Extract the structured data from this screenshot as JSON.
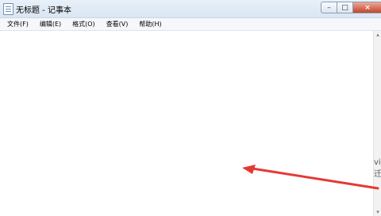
{
  "window": {
    "title": "无标题 - 记事本",
    "faint_text": "",
    "controls": {
      "minimize_icon": "minimize-icon",
      "maximize_icon": "maximize-icon",
      "close_icon": "close-icon"
    }
  },
  "menubar": {
    "items": [
      "文件(F)",
      "编辑(E)",
      "格式(O)",
      "查看(V)",
      "帮助(H)"
    ]
  },
  "editor": {
    "content": ""
  },
  "scrollbar": {
    "up": "▴",
    "down": "▾"
  },
  "side_fragment": {
    "line1": "vi",
    "line2": "迁"
  },
  "annotation": {
    "arrow_color": "#e53935"
  }
}
